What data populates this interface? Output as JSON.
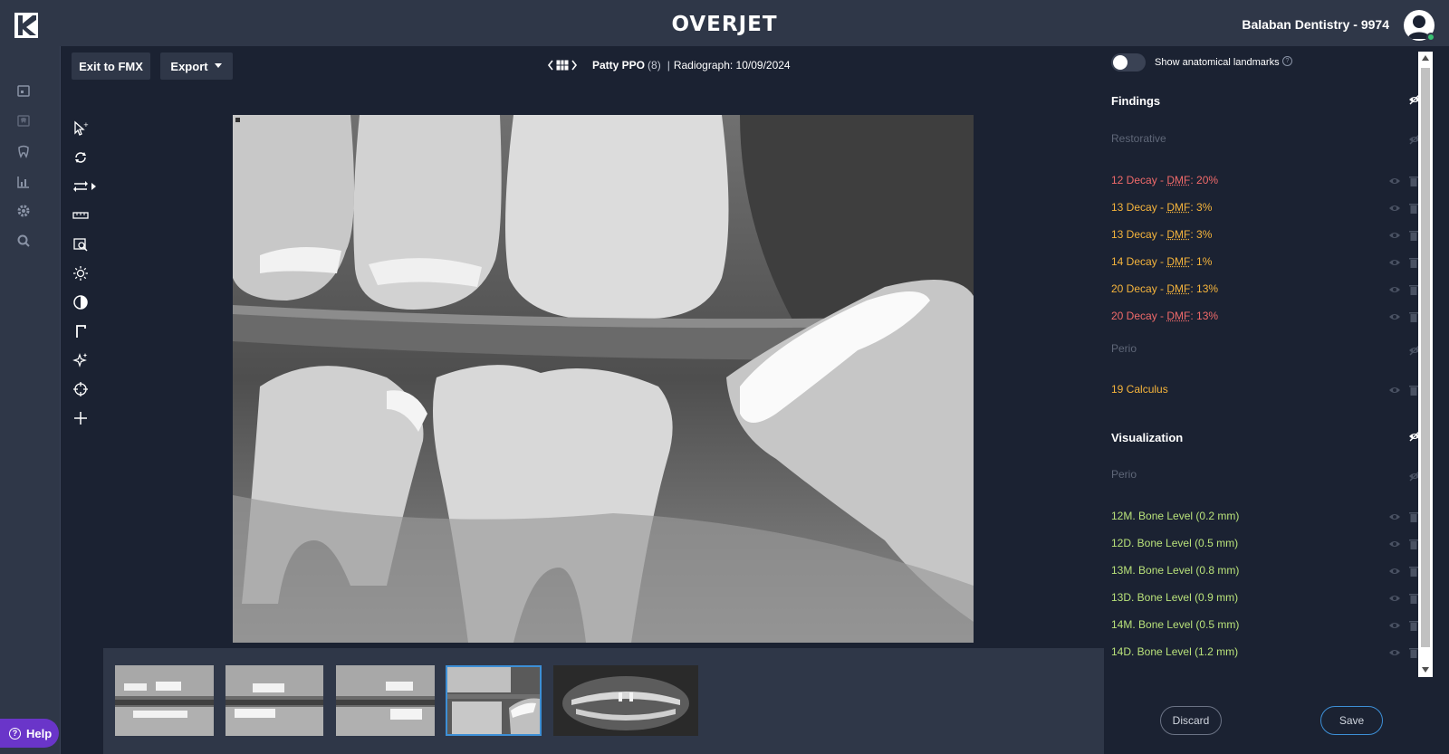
{
  "header": {
    "brand": "OVERJET",
    "clinic": "Balaban Dentistry - 9974"
  },
  "toolbar": {
    "exit_label": "Exit to FMX",
    "export_label": "Export"
  },
  "viewer": {
    "patient_name": "Patty PPO",
    "patient_count": "(8)",
    "separator": "|",
    "radiograph_label": "Radiograph: 10/09/2024"
  },
  "help": {
    "label": "Help"
  },
  "panel": {
    "landmarks_label": "Show anatomical landmarks",
    "findings_title": "Findings",
    "restorative_label": "Restorative",
    "findings": [
      {
        "tooth": "12 Decay - ",
        "dmf": "DMF",
        "value": ": 20%",
        "color": "#f06a6a"
      },
      {
        "tooth": "13 Decay - ",
        "dmf": "DMF",
        "value": ": 3%",
        "color": "#f5b43c"
      },
      {
        "tooth": "13 Decay - ",
        "dmf": "DMF",
        "value": ": 3%",
        "color": "#f5b43c"
      },
      {
        "tooth": "14 Decay - ",
        "dmf": "DMF",
        "value": ": 1%",
        "color": "#f5b43c"
      },
      {
        "tooth": "20 Decay - ",
        "dmf": "DMF",
        "value": ": 13%",
        "color": "#f5b43c"
      },
      {
        "tooth": "20 Decay - ",
        "dmf": "DMF",
        "value": ": 13%",
        "color": "#f06a6a"
      }
    ],
    "perio_label": "Perio",
    "calculus": "19 Calculus",
    "visualization_title": "Visualization",
    "vis_perio_label": "Perio",
    "bone_levels": [
      "12M. Bone Level (0.2 mm)",
      "12D. Bone Level (0.5 mm)",
      "13M. Bone Level (0.8 mm)",
      "13D. Bone Level (0.9 mm)",
      "14M. Bone Level (0.5 mm)",
      "14D. Bone Level (1.2 mm)"
    ],
    "discard_label": "Discard",
    "save_label": "Save"
  },
  "colors": {
    "calculus": "#f5b43c",
    "bone_level": "#b9e27a",
    "save_border": "#3d8fd6",
    "help_bg": "#6a35c9"
  }
}
